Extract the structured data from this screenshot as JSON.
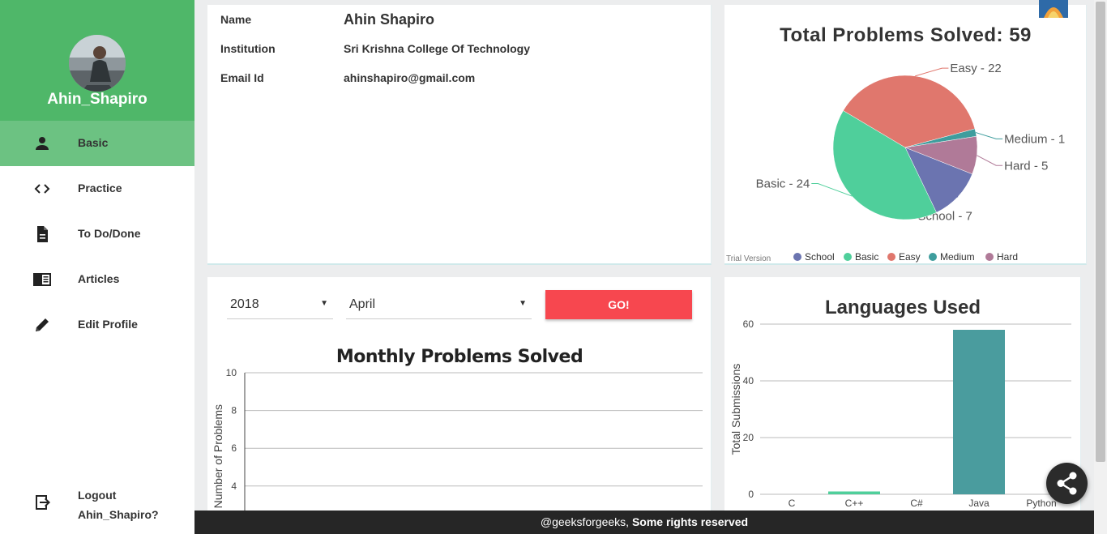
{
  "sidebar": {
    "username": "Ahin_Shapiro",
    "items": [
      {
        "label": "Basic",
        "icon": "person-icon"
      },
      {
        "label": "Practice",
        "icon": "code-icon"
      },
      {
        "label": "To Do/Done",
        "icon": "document-icon"
      },
      {
        "label": "Articles",
        "icon": "articles-icon"
      },
      {
        "label": "Edit Profile",
        "icon": "pencil-icon"
      }
    ],
    "logout_label": "Logout Ahin_Shapiro?",
    "accent_color": "#4fb769"
  },
  "profile": {
    "name_label": "Name",
    "name_value": "Ahin Shapiro",
    "institution_label": "Institution",
    "institution_value": "Sri Krishna College Of Technology",
    "email_label": "Email Id",
    "email_value": "ahinshapiro@gmail.com"
  },
  "filters": {
    "year": "2018",
    "month": "April",
    "go_label": "GO!"
  },
  "footer": {
    "handle": "@geeksforgeeks,",
    "rights": "Some rights reserved"
  },
  "chart_data": [
    {
      "type": "pie",
      "title": "Total Problems Solved:  59",
      "watermark": "Trial Version",
      "legend": [
        "School",
        "Basic",
        "Easy",
        "Medium",
        "Hard"
      ],
      "legend_position": "bottom",
      "slices": [
        {
          "name": "School",
          "value": 7,
          "label": "School - 7",
          "color": "#6b74b0"
        },
        {
          "name": "Basic",
          "value": 24,
          "label": "Basic - 24",
          "color": "#4fcf9b"
        },
        {
          "name": "Easy",
          "value": 22,
          "label": "Easy - 22",
          "color": "#e0776d"
        },
        {
          "name": "Medium",
          "value": 1,
          "label": "Medium - 1",
          "color": "#3e9d9d"
        },
        {
          "name": "Hard",
          "value": 5,
          "label": "Hard - 5",
          "color": "#b07a98"
        }
      ]
    },
    {
      "type": "line",
      "title": "Monthly Problems Solved",
      "ylabel": "Number of Problems",
      "ylim": [
        0,
        10
      ],
      "yticks": [
        4,
        6,
        8,
        10
      ],
      "series": [],
      "grid": true
    },
    {
      "type": "bar",
      "title": "Languages Used",
      "ylabel": "Total Submissions",
      "categories": [
        "C",
        "C++",
        "C#",
        "Java",
        "Python"
      ],
      "values": [
        0,
        1,
        0,
        58,
        0
      ],
      "colors": [
        "#4fcf9b",
        "#4fcf9b",
        "#4fcf9b",
        "#4a9c9e",
        "#4fcf9b"
      ],
      "ylim": [
        0,
        60
      ],
      "yticks": [
        0,
        20,
        40,
        60
      ],
      "grid": true
    }
  ]
}
